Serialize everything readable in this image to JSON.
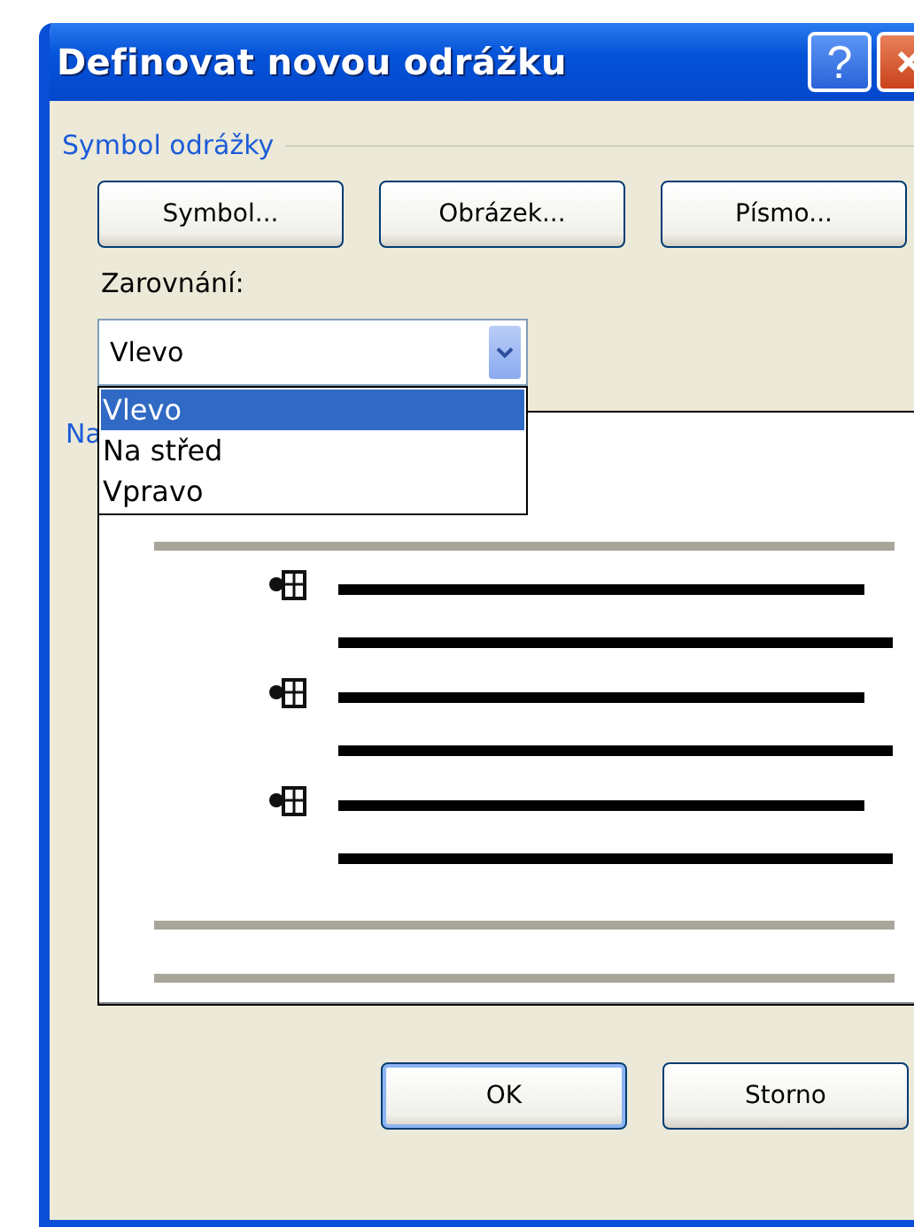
{
  "window": {
    "title": "Definovat novou odrážku",
    "controls": [
      {
        "kind": "help",
        "label": "?"
      },
      {
        "kind": "close"
      }
    ]
  },
  "symbol_group": {
    "label": "Symbol odrážky",
    "buttons": [
      "Symbol...",
      "Obrázek...",
      "Písmo..."
    ]
  },
  "alignment": {
    "label": "Zarovnání:",
    "value": "Vlevo",
    "expanded": true,
    "options": [
      {
        "label": "Vlevo",
        "selected": true
      },
      {
        "label": "Na střed",
        "selected": false
      },
      {
        "label": "Vpravo",
        "selected": false
      }
    ]
  },
  "preview": {
    "label": "Na"
  },
  "buttons": [
    {
      "label": "OK",
      "default": true
    },
    {
      "label": "Storno",
      "default": false
    }
  ]
}
